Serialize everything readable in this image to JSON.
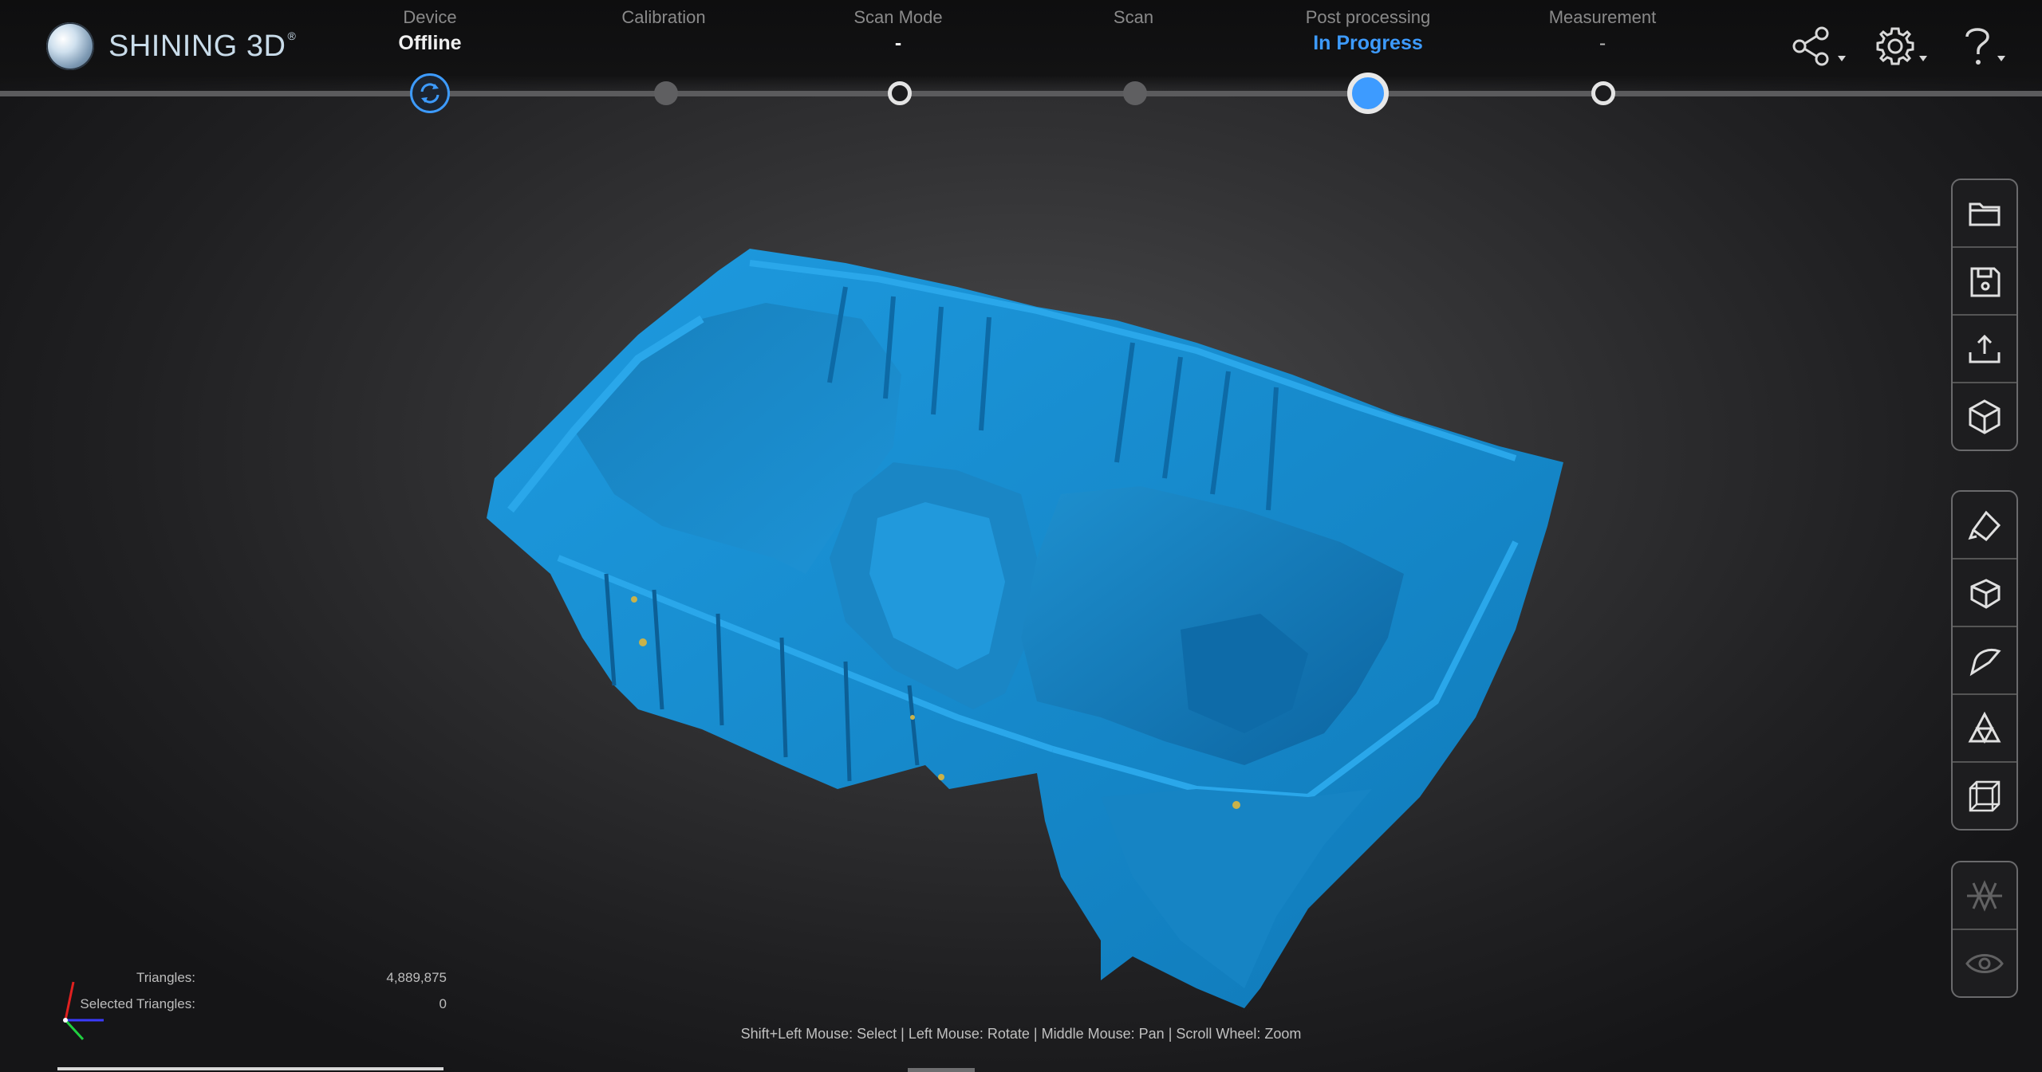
{
  "app": {
    "logo_text": "SHINING 3D",
    "logo_reg": "®"
  },
  "steps": [
    {
      "label": "Device",
      "status": "Offline",
      "state": "offline"
    },
    {
      "label": "Calibration",
      "status": "",
      "state": "idle"
    },
    {
      "label": "Scan Mode",
      "status": "-",
      "state": "idle"
    },
    {
      "label": "Scan",
      "status": "",
      "state": "idle"
    },
    {
      "label": "Post processing",
      "status": "In Progress",
      "state": "active"
    },
    {
      "label": "Measurement",
      "status": "-",
      "state": "idle"
    }
  ],
  "header_icons": [
    "share-icon",
    "settings-icon",
    "help-icon"
  ],
  "toolbar": {
    "file_group": [
      "folder-icon",
      "save-icon",
      "export-icon",
      "model-icon"
    ],
    "view_group": [
      "clipping-icon",
      "view-cube-icon",
      "curvature-icon",
      "mesh-triangle-icon",
      "wireframe-box-icon"
    ],
    "display_group": [
      "normals-toggle-icon",
      "visibility-icon"
    ]
  },
  "stats": {
    "triangles_label": "Triangles:",
    "triangles_value": "4,889,875",
    "selected_label": "Selected Triangles:",
    "selected_value": "0"
  },
  "hint": "Shift+Left Mouse: Select | Left Mouse: Rotate | Middle Mouse: Pan | Scroll Wheel: Zoom",
  "colors": {
    "accent": "#3d9bff",
    "model": "#1a8fd0",
    "background": "#2a2a2c"
  }
}
